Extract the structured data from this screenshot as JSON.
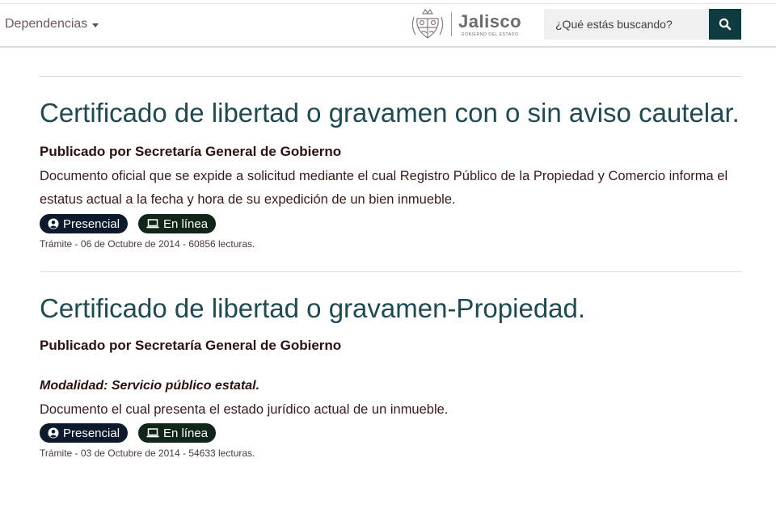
{
  "header": {
    "dependencias_label": "Dependencias",
    "logo_name": "Jalisco",
    "logo_sub": "GOBIERNO DEL ESTADO",
    "search_placeholder": "¿Qué estás buscando?"
  },
  "colors": {
    "title": "#1e4a52",
    "search_button": "#0e3b3f",
    "tag_presencial": "#0d1a2e",
    "tag_linea": "#102618"
  },
  "icons": {
    "search": "search-icon",
    "presencial": "user-circle-icon",
    "linea": "laptop-icon"
  },
  "results": [
    {
      "title": "Certificado de libertad o gravamen con o sin aviso cautelar.",
      "publisher": "Publicado por Secretaría General de Gobierno",
      "modalidad": "",
      "description": "Documento oficial que se expide a solicitud mediante el cual Registro Público de la Propiedad y Comercio informa el estatus actual a la fecha y hora de su expedición de un bien inmueble.",
      "tags": [
        "Presencial",
        "En línea"
      ],
      "meta": "Trámite - 06 de Octubre de 2014 - 60856 lecturas."
    },
    {
      "title": "Certificado de libertad o gravamen-Propiedad.",
      "publisher": "Publicado por Secretaría General de Gobierno",
      "modalidad": "Modalidad: Servicio público estatal.",
      "description": "Documento el cual presenta el estado jurídico actual de un inmueble.",
      "tags": [
        "Presencial",
        "En línea"
      ],
      "meta": "Trámite - 03 de Octubre de 2014 - 54633 lecturas."
    }
  ]
}
